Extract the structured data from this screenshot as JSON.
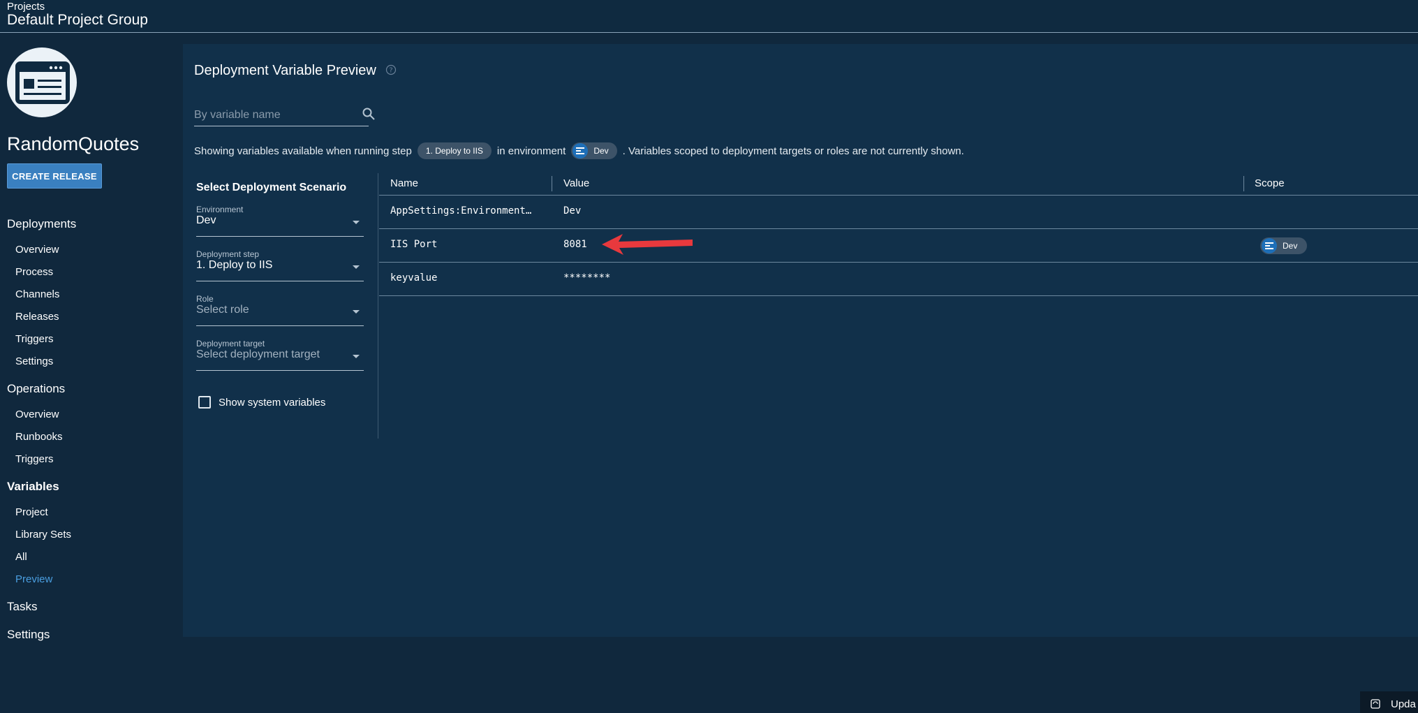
{
  "header": {
    "breadcrumb": "Projects",
    "title": "Default Project Group"
  },
  "sidebar": {
    "project_name": "RandomQuotes",
    "create_release_label": "CREATE RELEASE",
    "sections": {
      "deployments": "Deployments",
      "operations": "Operations",
      "variables": "Variables",
      "tasks": "Tasks",
      "settings": "Settings"
    },
    "deployments_items": [
      "Overview",
      "Process",
      "Channels",
      "Releases",
      "Triggers",
      "Settings"
    ],
    "operations_items": [
      "Overview",
      "Runbooks",
      "Triggers"
    ],
    "variables_items": [
      "Project",
      "Library Sets",
      "All",
      "Preview"
    ],
    "active_item": "Preview"
  },
  "main": {
    "title": "Deployment Variable Preview",
    "search_placeholder": "By variable name",
    "info": {
      "prefix": "Showing variables available when running step",
      "step_chip": "1. Deploy to IIS",
      "middle": "in environment",
      "env_chip": "Dev",
      "suffix": ". Variables scoped to deployment targets or roles are not currently shown."
    },
    "scenario": {
      "title": "Select Deployment Scenario",
      "environment_label": "Environment",
      "environment_value": "Dev",
      "step_label": "Deployment step",
      "step_value": "1. Deploy to IIS",
      "role_label": "Role",
      "role_placeholder": "Select role",
      "target_label": "Deployment target",
      "target_placeholder": "Select deployment target",
      "show_system_label": "Show system variables"
    },
    "table": {
      "columns": [
        "Name",
        "Value",
        "Scope"
      ],
      "rows": [
        {
          "name": "AppSettings:Environment…",
          "value": "Dev",
          "scope": ""
        },
        {
          "name": "IIS Port",
          "value": "8081",
          "scope": "Dev"
        },
        {
          "name": "keyvalue",
          "value": "********",
          "scope": ""
        }
      ]
    }
  },
  "footer": {
    "update_label": "Upda"
  },
  "colors": {
    "background": "#10283d",
    "panel": "#11304a",
    "accent": "#3a80c0",
    "active_link": "#4a9ee0",
    "arrow": "#e8393d"
  }
}
